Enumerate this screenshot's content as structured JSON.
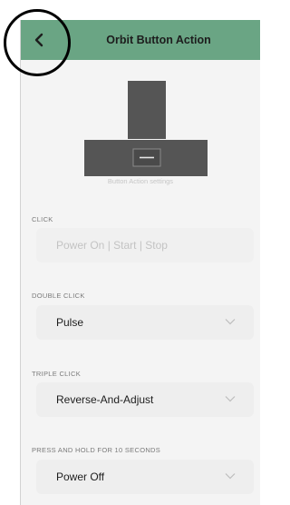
{
  "header": {
    "title": "Orbit Button Action"
  },
  "device": {
    "caption": "Button Action settings"
  },
  "sections": [
    {
      "label": "CLICK",
      "value": "Power On | Start | Stop",
      "disabled": true
    },
    {
      "label": "DOUBLE CLICK",
      "value": "Pulse"
    },
    {
      "label": "TRIPLE CLICK",
      "value": "Reverse-And-Adjust"
    },
    {
      "label": "PRESS AND HOLD FOR 10 SECONDS",
      "value": "Power Off"
    }
  ],
  "colors": {
    "header": "#6aa584",
    "device": "#555555",
    "background": "#f4f4f4"
  }
}
